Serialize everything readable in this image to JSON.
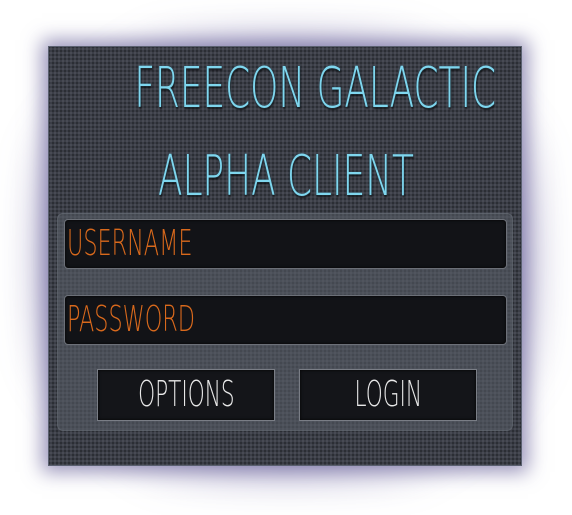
{
  "window": {
    "title_line1": "FREECON GALACTIC",
    "title_line2": "ALPHA CLIENT"
  },
  "form": {
    "username_placeholder": "USERNAME",
    "password_placeholder": "PASSWORD",
    "options_label": "OPTIONS",
    "login_label": "LOGIN"
  },
  "colors": {
    "title": "#7fd6ee",
    "field_text": "#d9691c",
    "button_text": "#e8e8e8",
    "panel_background": "#3b3e47",
    "field_background": "#121317"
  }
}
